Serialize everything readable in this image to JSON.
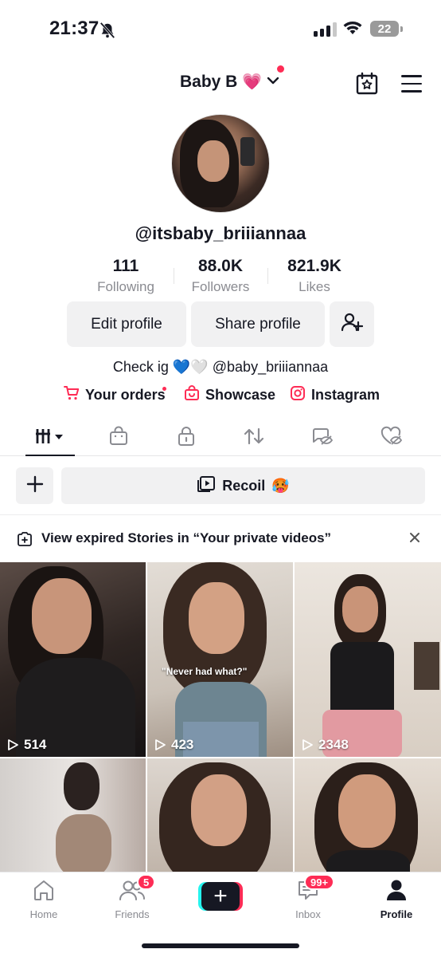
{
  "status_bar": {
    "time": "21:37",
    "battery": "22"
  },
  "header": {
    "account_name": "Baby B",
    "account_emoji": "💗"
  },
  "profile": {
    "username": "@itsbaby_briiiannaa",
    "stats": [
      {
        "value": "111",
        "label": "Following"
      },
      {
        "value": "88.0K",
        "label": "Followers"
      },
      {
        "value": "821.9K",
        "label": "Likes"
      }
    ],
    "edit_profile_label": "Edit profile",
    "share_profile_label": "Share profile",
    "bio": {
      "prefix": "Check ig",
      "emojis": [
        "💙",
        "🤍"
      ],
      "handle": "@baby_briiiannaa"
    },
    "links": {
      "orders": "Your orders",
      "showcase": "Showcase",
      "instagram": "Instagram"
    }
  },
  "tabs": [
    "videos-grid-icon",
    "shop-bag-icon",
    "lock-icon",
    "repost-icon",
    "tagged-eye-off-icon",
    "liked-heart-off-icon"
  ],
  "quick_actions": {
    "recoil_label": "Recoil",
    "recoil_emoji": "🥵"
  },
  "stories_notice": {
    "text": "View expired Stories in “Your private videos”"
  },
  "videos": [
    {
      "views": "514"
    },
    {
      "views": "423",
      "caption": "\"Never had what?\""
    },
    {
      "views": "2348"
    },
    {
      "views": ""
    },
    {
      "views": ""
    },
    {
      "views": ""
    }
  ],
  "bottom_nav": {
    "home": "Home",
    "friends": "Friends",
    "friends_badge": "5",
    "inbox": "Inbox",
    "inbox_badge": "99+",
    "profile": "Profile"
  },
  "colors": {
    "accent": "#fe2c55",
    "create_cyan": "#25f4ee",
    "text": "#161823",
    "muted": "#8a8b91"
  }
}
